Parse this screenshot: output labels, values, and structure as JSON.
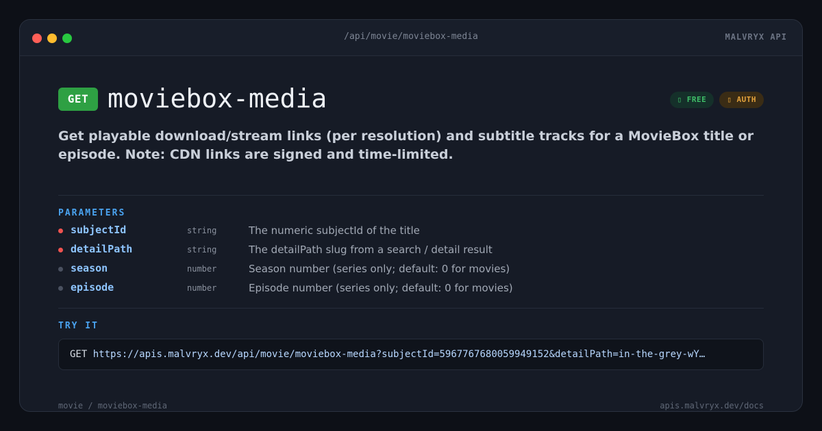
{
  "window": {
    "path": "/api/movie/moviebox-media",
    "brand": "MALVRYX API"
  },
  "endpoint": {
    "method": "GET",
    "name": "moviebox-media",
    "badges": [
      {
        "label": "▯ FREE",
        "icon": "free-icon"
      },
      {
        "label": "▯ AUTH",
        "icon": "auth-icon"
      }
    ],
    "description": "Get playable download/stream links (per resolution) and subtitle tracks for a MovieBox title or episode. Note: CDN links are signed and time-limited."
  },
  "parameters": {
    "label": "PARAMETERS",
    "items": [
      {
        "name": "subjectId",
        "type": "string",
        "description": "The numeric subjectId of the title",
        "required": true
      },
      {
        "name": "detailPath",
        "type": "string",
        "description": "The detailPath slug from a search / detail result",
        "required": true
      },
      {
        "name": "season",
        "type": "number",
        "description": "Season number (series only; default: 0 for movies)",
        "required": false
      },
      {
        "name": "episode",
        "type": "number",
        "description": "Episode number (series only; default: 0 for movies)",
        "required": false
      }
    ]
  },
  "try_it": {
    "label": "TRY IT",
    "verb": "GET",
    "url": "https://apis.malvryx.dev/api/movie/moviebox-media?subjectId=5967767680059949152&detailPath=in-the-grey-wY…"
  },
  "footer": {
    "left": "movie / moviebox-media",
    "right": "apis.malvryx.dev/docs"
  },
  "colors": {
    "method_bg": "#2ea043",
    "accent": "#4aa3f0",
    "required_dot": "#ef5350",
    "optional_dot": "#4a5160"
  }
}
